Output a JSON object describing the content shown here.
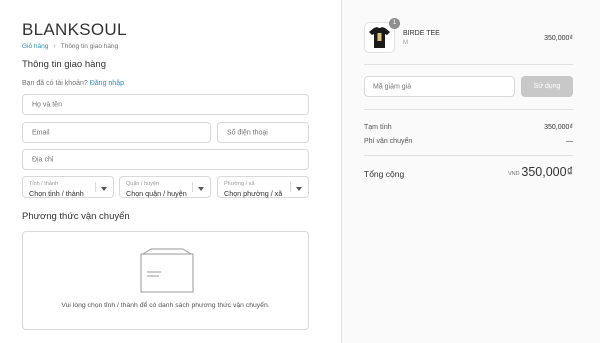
{
  "brand": {
    "logo": "BLANKSOUL"
  },
  "breadcrumb": {
    "cart": "Giỏ hàng",
    "separator": "›",
    "current": "Thông tin giao hàng"
  },
  "shipping_info": {
    "title": "Thông tin giao hàng",
    "have_account": "Bạn đã có tài khoản?",
    "login_link": "Đăng nhập",
    "fullname_placeholder": "Họ và tên",
    "email_placeholder": "Email",
    "phone_placeholder": "Số điện thoại",
    "address_placeholder": "Địa chỉ",
    "province": {
      "label": "Tỉnh / thành",
      "value": "Chọn tỉnh / thành"
    },
    "district": {
      "label": "Quận / huyện",
      "value": "Chọn quận / huyện"
    },
    "ward": {
      "label": "Phường / xã",
      "value": "Chọn phường / xã"
    }
  },
  "shipping_method": {
    "title": "Phương thức vận chuyển",
    "message": "Vui lòng chọn tỉnh / thành để có danh sách phương thức vận chuyển."
  },
  "order_summary": {
    "product": {
      "quantity": "1",
      "name": "BIRDE TEE",
      "variant": "M",
      "price": "350,000₫"
    },
    "discount_placeholder": "Mã giảm giá",
    "apply_label": "Sử dụng",
    "subtotal_label": "Tạm tính",
    "subtotal_value": "350,000₫",
    "shipping_label": "Phí vận chuyển",
    "shipping_value": "—",
    "total_label": "Tổng cộng",
    "currency": "VND",
    "total_value": "350,000₫"
  },
  "colors": {
    "link": "#338dbc",
    "button_disabled": "#c8c8c8",
    "sidebar_bg": "#fafafa"
  },
  "icons": {
    "box": "box-icon",
    "tshirt": "tshirt-thumbnail"
  }
}
